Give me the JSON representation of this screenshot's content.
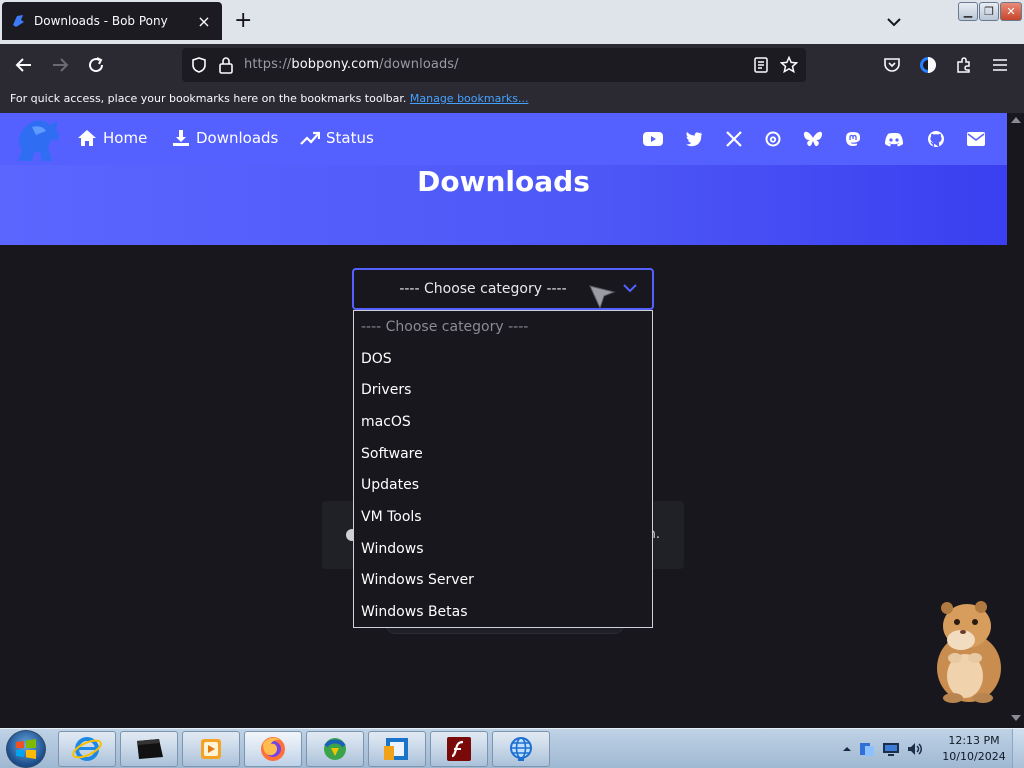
{
  "browser": {
    "tab_title": "Downloads - Bob Pony",
    "url_prefix": "https://",
    "url_host": "bobpony.com",
    "url_path": "/downloads/",
    "bookmarks_message": "For quick access, place your bookmarks here on the bookmarks toolbar.",
    "bookmarks_link": "Manage bookmarks..."
  },
  "site": {
    "nav": [
      {
        "label": "Home",
        "icon": "home-icon"
      },
      {
        "label": "Downloads",
        "icon": "download-icon"
      },
      {
        "label": "Status",
        "icon": "trending-up-icon"
      }
    ],
    "social_icons": [
      "youtube-icon",
      "twitter-icon",
      "x-icon",
      "threads-icon",
      "bluesky-icon",
      "mastodon-icon",
      "discord-icon",
      "github-icon",
      "mail-icon"
    ],
    "page_title": "Downloads",
    "accent_color": "#5561ff",
    "hidden_text_tail": "n."
  },
  "category_select": {
    "selected": "---- Choose category ----",
    "options": [
      "---- Choose category ----",
      "DOS",
      "Drivers",
      "macOS",
      "Software",
      "Updates",
      "VM Tools",
      "Windows",
      "Windows Server",
      "Windows Betas"
    ]
  },
  "taskbar": {
    "apps": [
      "internet-explorer-icon",
      "terminal-icon",
      "media-player-icon",
      "firefox-icon",
      "download-manager-icon",
      "virtualbox-icon",
      "flash-icon",
      "network-globe-icon"
    ],
    "time": "12:13 PM",
    "date": "10/10/2024"
  }
}
